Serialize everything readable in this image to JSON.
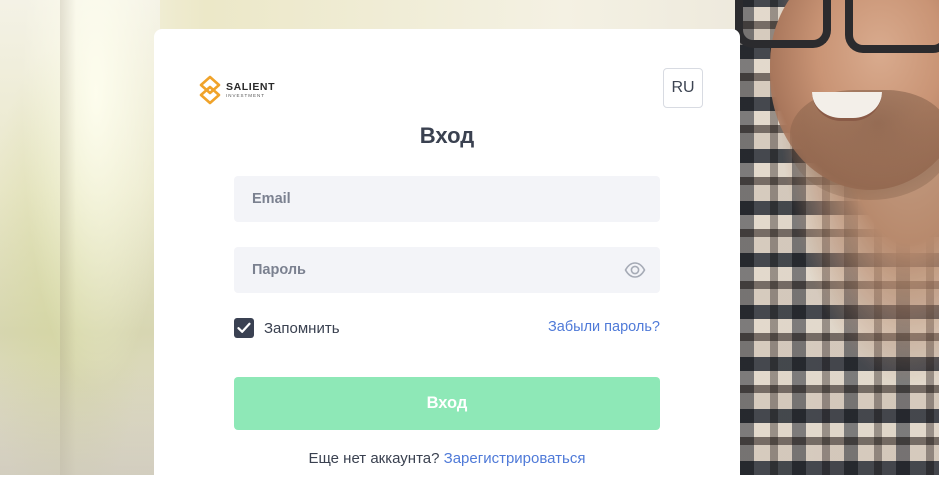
{
  "brand": {
    "name": "SALIENT",
    "tagline": "INVESTMENT",
    "accent": "#f0a32a"
  },
  "language": {
    "current": "RU"
  },
  "login": {
    "title": "Вход",
    "email_placeholder": "Email",
    "password_placeholder": "Пароль",
    "password_toggle_icon": "eye-icon",
    "remember_label": "Запомнить",
    "remember_checked": true,
    "forgot_link": "Забыли пароль?",
    "submit_label": "Вход",
    "no_account_text": "Еще нет аккаунта?",
    "register_link": "Зарегистрироваться"
  },
  "colors": {
    "submit_bg": "#8ee8b7",
    "link": "#4f7ad8",
    "text": "#3a4150",
    "field_bg": "#f3f4f8",
    "checkbox_bg": "#3a4152"
  }
}
